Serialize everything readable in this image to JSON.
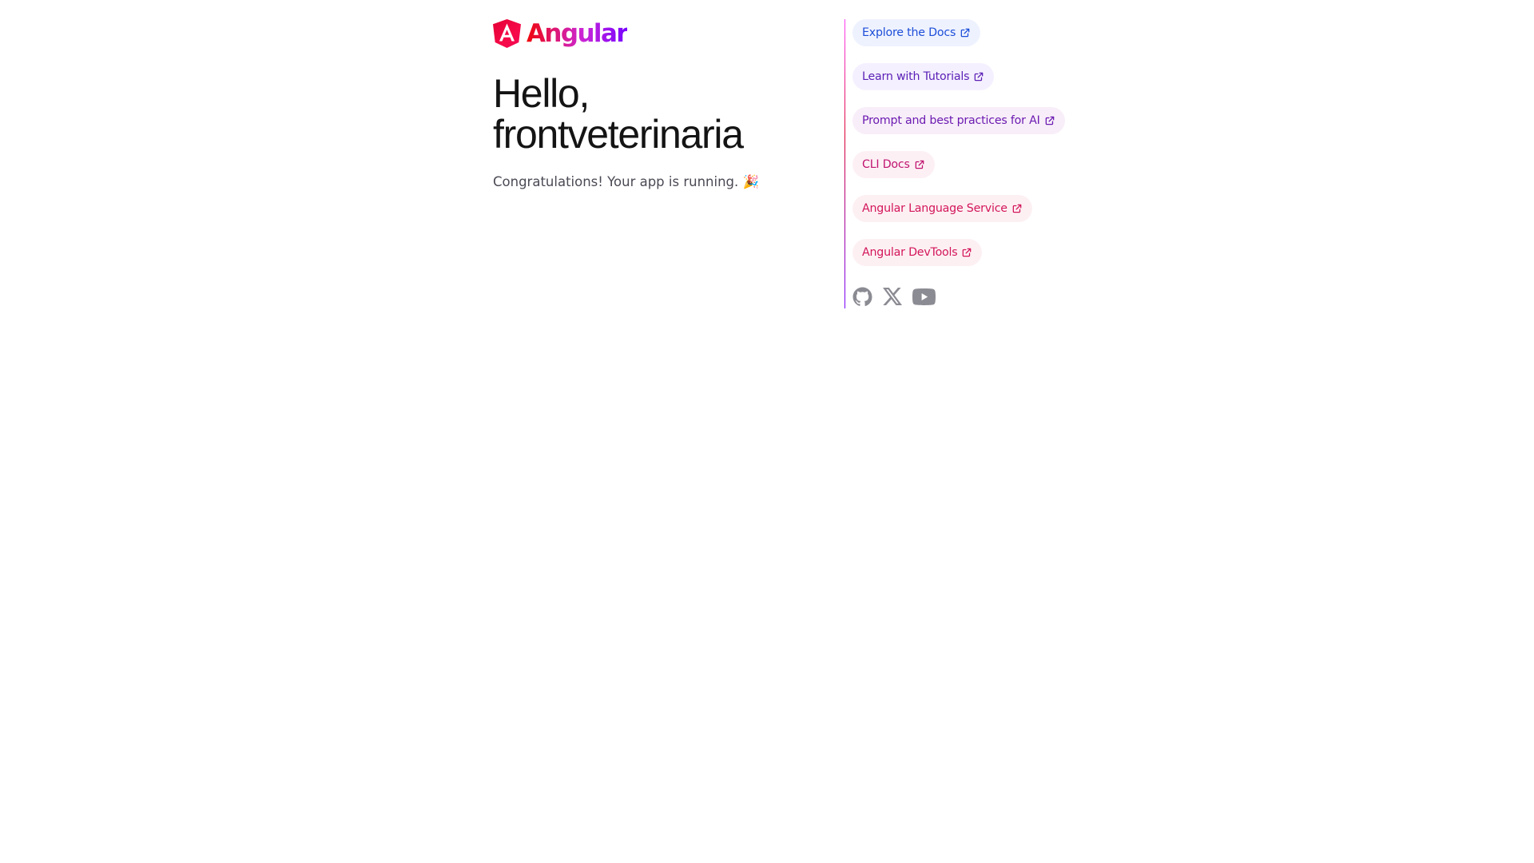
{
  "brand": {
    "wordmark": "Angular"
  },
  "main": {
    "title_line1": "Hello,",
    "title_line2": "frontveterinaria",
    "subtitle": "Congratulations! Your app is running. 🎉"
  },
  "links": [
    {
      "label": "Explore the Docs",
      "color": "#1d4ed8",
      "bg": "#eef2ff",
      "icon": "external-link-icon"
    },
    {
      "label": "Learn with Tutorials",
      "color": "#5b21b6",
      "bg": "#f5f0ff",
      "icon": "external-link-icon"
    },
    {
      "label": "Prompt and best practices for AI",
      "color": "#6b1ab1",
      "bg": "#f8eef9",
      "icon": "external-link-icon"
    },
    {
      "label": "CLI Docs",
      "color": "#c0136f",
      "bg": "#fdf0f5",
      "icon": "external-link-icon"
    },
    {
      "label": "Angular Language Service",
      "color": "#d3165a",
      "bg": "#fdf0f3",
      "icon": "external-link-icon"
    },
    {
      "label": "Angular DevTools",
      "color": "#d3165a",
      "bg": "#fdf0f3",
      "icon": "external-link-icon"
    }
  ],
  "social": [
    {
      "name": "github-icon"
    },
    {
      "name": "x-icon"
    },
    {
      "name": "youtube-icon"
    }
  ],
  "colors": {
    "icon_gray": "#8b8b93",
    "title": "#141414",
    "subtitle": "#4a4a55"
  }
}
